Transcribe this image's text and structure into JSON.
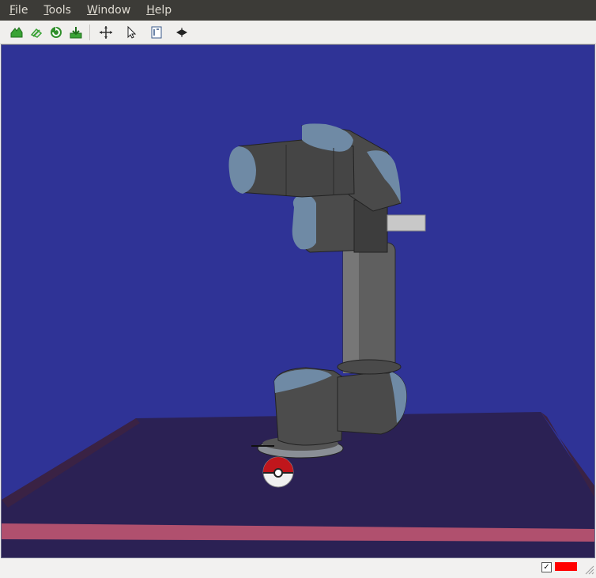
{
  "menu": {
    "items": [
      {
        "label": "File",
        "mnemonic": "F",
        "rest": "ile"
      },
      {
        "label": "Tools",
        "mnemonic": "T",
        "rest": "ools"
      },
      {
        "label": "Window",
        "mnemonic": "W",
        "rest": "indow"
      },
      {
        "label": "Help",
        "mnemonic": "H",
        "rest": "elp"
      }
    ]
  },
  "toolbar": {
    "icons": [
      "open-world-icon",
      "save-world-icon",
      "reload-icon",
      "export-icon",
      "move-icon",
      "select-pointer-icon",
      "measure-icon",
      "view-plane-icon"
    ]
  },
  "scene": {
    "background_color": "#2f3396",
    "floor_color": "#2b2154",
    "floor_edge_color": "#b0506e",
    "robot_color": "#4a4a4a",
    "joint_cap_color": "#6f8aa5",
    "ball_top_color": "#c0161c",
    "ball_bottom_color": "#f0f0f0"
  },
  "status": {
    "checkbox_checked": true,
    "checkbox_glyph": "✓",
    "indicator_color": "#ff0000"
  }
}
